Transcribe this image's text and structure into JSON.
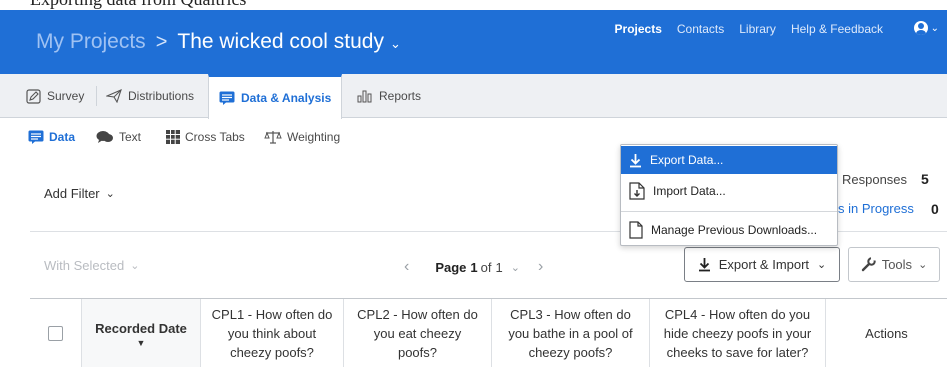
{
  "header": {
    "breadcrumb_root": "My Projects",
    "breadcrumb_sep": ">",
    "project_name": "The wicked cool study",
    "nav": [
      "Projects",
      "Contacts",
      "Library",
      "Help & Feedback"
    ]
  },
  "tabs": [
    "Survey",
    "Distributions",
    "Data & Analysis",
    "Reports"
  ],
  "subtabs": [
    "Data",
    "Text",
    "Cross Tabs",
    "Weighting"
  ],
  "filter": {
    "label": "Add Filter"
  },
  "stats": {
    "responses_label": "Responses",
    "responses_value": "5",
    "in_progress_label": "s in Progress",
    "in_progress_value": "0"
  },
  "toolbar": {
    "with_selected": "With Selected",
    "page_label": "Page",
    "page_current": "1",
    "page_of": "of",
    "page_total": "1",
    "export_import": "Export & Import",
    "tools": "Tools"
  },
  "dropdown": {
    "items": [
      "Export Data...",
      "Import Data...",
      "Manage Previous Downloads..."
    ]
  },
  "table": {
    "columns": [
      "Recorded Date",
      "CPL1 - How often do you think about cheezy poofs?",
      "CPL2 - How often do you eat cheezy poofs?",
      "CPL3 - How often do you bathe in a pool of cheezy poofs?",
      "CPL4 - How often do you hide cheezy poofs in your cheeks to save for later?",
      "Actions"
    ]
  },
  "colors": {
    "accent": "#1f6fd6",
    "header_bg": "#1f6fd6",
    "tab_bar_bg": "#eef0f3"
  }
}
